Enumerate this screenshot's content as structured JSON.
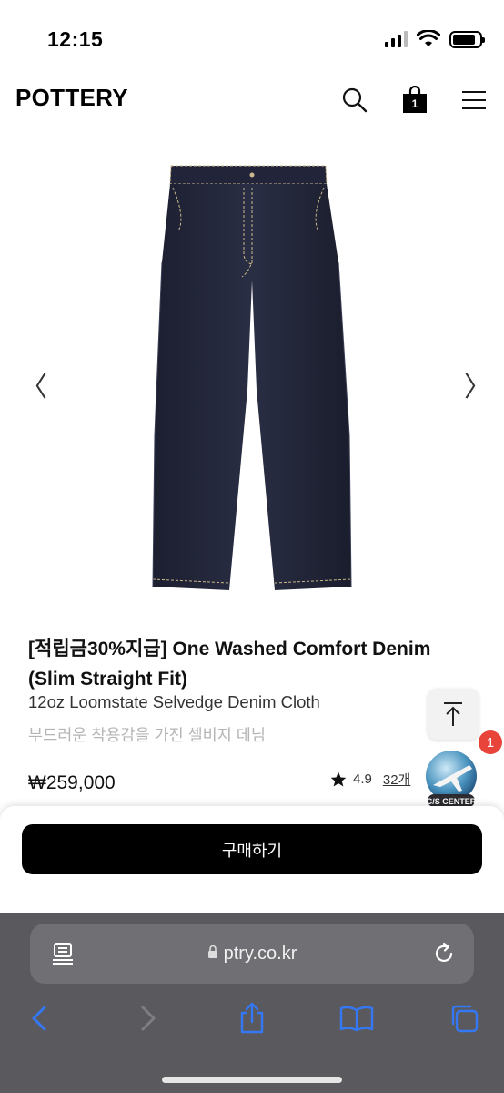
{
  "status_bar": {
    "time": "12:15"
  },
  "header": {
    "logo": "POTTERY",
    "cart_count": "1"
  },
  "icons": {
    "search": "search-icon",
    "cart": "shopping-bag-icon",
    "menu": "hamburger-menu-icon",
    "prev": "chevron-left-icon",
    "next": "chevron-right-icon"
  },
  "carousel": {
    "prev_label": "〈",
    "next_label": "〉"
  },
  "product": {
    "title": "[적립금30%지급] One Washed Comfort Denim (Slim Straight Fit)",
    "subtitle": "12oz Loomstate Selvedge Denim Cloth",
    "description": "부드러운 착용감을 가진 셀비지 데님",
    "price": "₩259,000",
    "rating": "4.9",
    "review_count": "32개"
  },
  "cs_center": {
    "label": "C/S CENTER",
    "badge": "1"
  },
  "purchase": {
    "button_label": "구매하기"
  },
  "browser": {
    "url": "ptry.co.kr"
  },
  "colors": {
    "accent": "#000000",
    "badge": "#e8443a",
    "safari_blue": "#3478f6",
    "denim": "#23263a"
  }
}
